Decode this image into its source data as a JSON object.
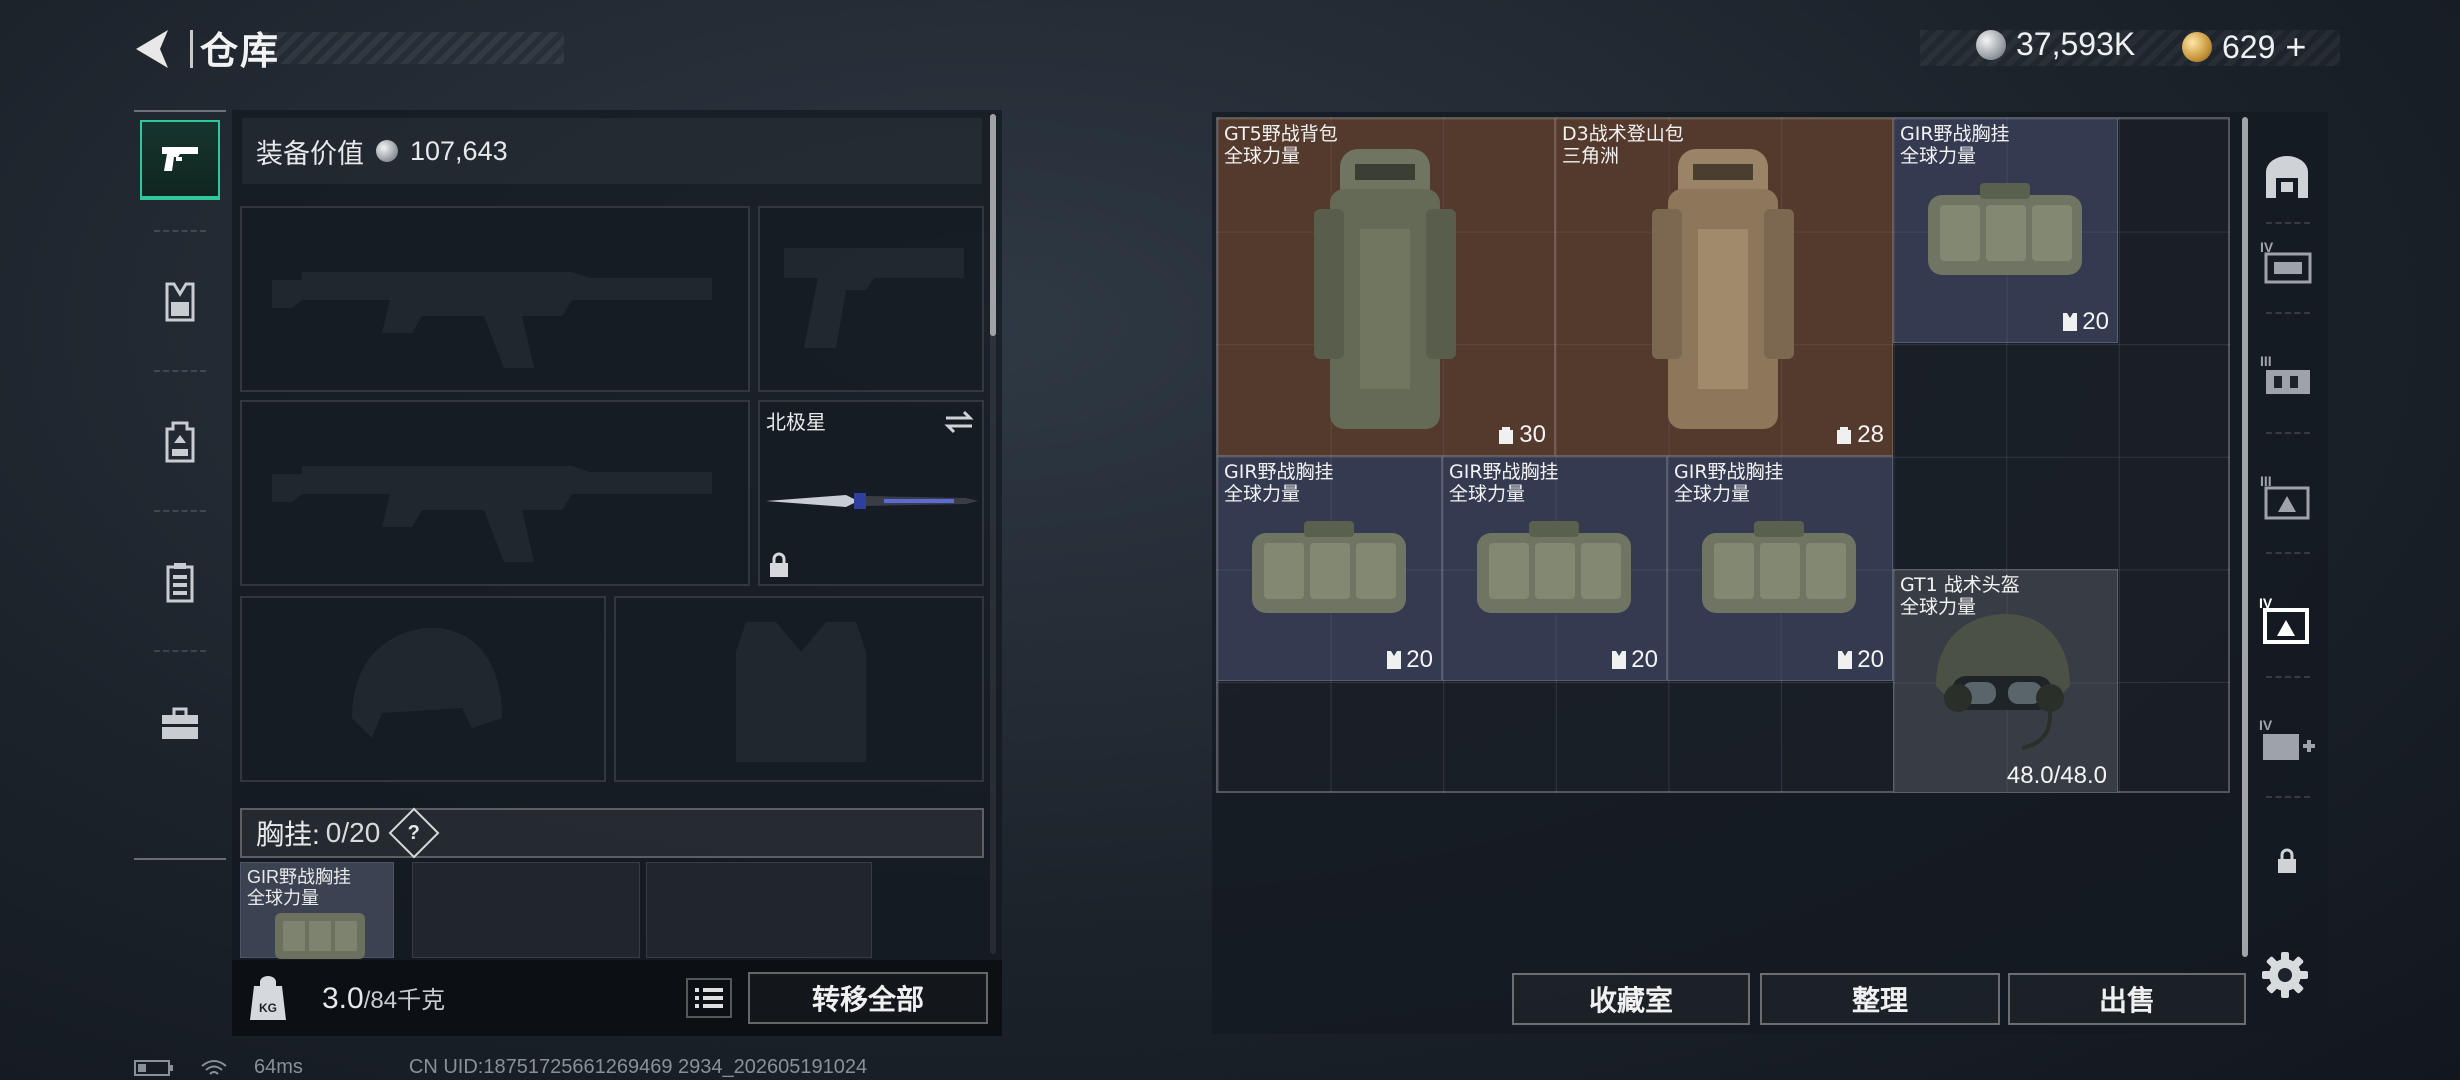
{
  "header": {
    "title": "仓库"
  },
  "currency": {
    "silver_amount": "37,593K",
    "gold_amount": "629",
    "add_symbol": "+",
    "icons": [
      "silver-coin-icon",
      "gold-coin-icon"
    ]
  },
  "left_nav": {
    "items": [
      "pistol-icon",
      "chest-rig-icon",
      "backpack-icon",
      "armor-icon",
      "toolbox-icon"
    ],
    "active_index": 0,
    "accent_color": "#2fc79b"
  },
  "equipment": {
    "value_label": "装备价值",
    "value_amount": "107,643",
    "melee_name": "北极星",
    "chest_label": "胸挂:",
    "chest_count": "0/20",
    "help_mark": "?",
    "chest_item": {
      "name": "GIR野战胸挂",
      "sub": "全球力量"
    }
  },
  "weight": {
    "current": "3.0",
    "max": "/84千克"
  },
  "buttons": {
    "transfer_all": "转移全部",
    "collection": "收藏室",
    "organize": "整理",
    "sell": "出售"
  },
  "stash": {
    "items": [
      {
        "name": "GT5野战背包",
        "sub": "全球力量",
        "capacity": "30",
        "kind": "backpack"
      },
      {
        "name": "D3战术登山包",
        "sub": "三角洲",
        "capacity": "28",
        "kind": "backpack"
      },
      {
        "name": "GIR野战胸挂",
        "sub": "全球力量",
        "capacity": "20",
        "kind": "rig"
      },
      {
        "name": "GIR野战胸挂",
        "sub": "全球力量",
        "capacity": "20",
        "kind": "rig"
      },
      {
        "name": "GIR野战胸挂",
        "sub": "全球力量",
        "capacity": "20",
        "kind": "rig"
      },
      {
        "name": "GIR野战胸挂",
        "sub": "全球力量",
        "capacity": "20",
        "kind": "rig"
      },
      {
        "name": "GT1 战术头盔",
        "sub": "全球力量",
        "durability": "48.0/48.0",
        "kind": "helmet"
      }
    ]
  },
  "right_nav": {
    "items": [
      "vault-icon",
      "tier4-storage-icon",
      "tier3-storage-icon",
      "tier3-box-icon",
      "tier4-box-icon",
      "tier4-medkit-icon",
      "lock-icon"
    ]
  },
  "footer": {
    "ping": "64ms",
    "uid": "CN UID:18751725661269469 2934_202605191024"
  }
}
